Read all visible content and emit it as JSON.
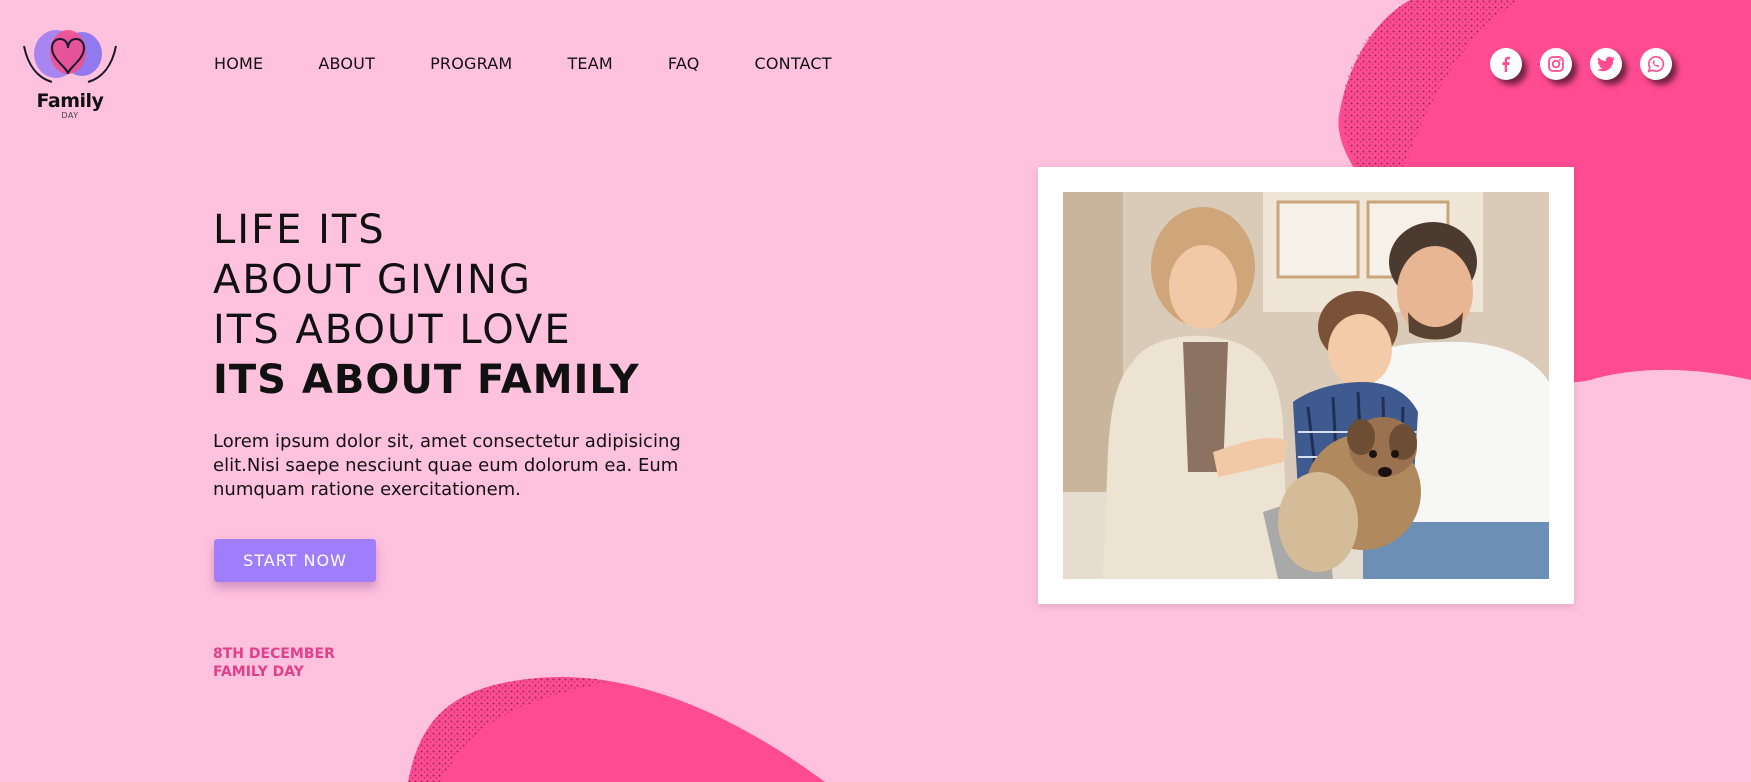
{
  "brand": {
    "logo_word": "Family",
    "logo_sub": "DAY",
    "colors": {
      "background": "#ffc2de",
      "accent_pink": "#ff4b91",
      "button_purple": "#a07dfa",
      "date_pink": "#e0408b"
    }
  },
  "nav": {
    "items": [
      {
        "label": "HOME"
      },
      {
        "label": "ABOUT"
      },
      {
        "label": "PROGRAM"
      },
      {
        "label": "TEAM"
      },
      {
        "label": "FAQ"
      },
      {
        "label": "CONTACT"
      }
    ]
  },
  "social": {
    "icons": [
      "facebook-icon",
      "instagram-icon",
      "twitter-icon",
      "whatsapp-icon"
    ]
  },
  "hero": {
    "line1": "LIFE ITS",
    "line2": "ABOUT GIVING",
    "line3": "ITS ABOUT LOVE",
    "line4": "ITS ABOUT FAMILY",
    "description": "Lorem ipsum dolor sit, amet consectetur adipisicing elit.Nisi saepe nesciunt quae eum dolorum ea. Eum numquam ratione exercitationem.",
    "button_label": "START NOW",
    "date_line1": "8TH DECEMBER",
    "date_line2": "FAMILY DAY"
  }
}
